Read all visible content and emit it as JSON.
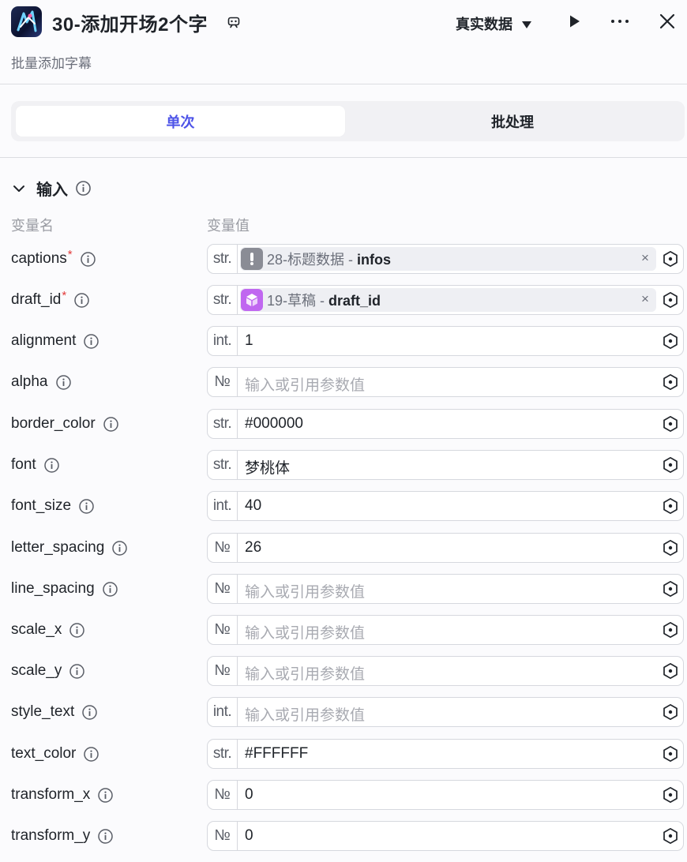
{
  "header": {
    "title": "30-添加开场2个字",
    "subtitle": "批量添加字幕",
    "mode_label": "真实数据"
  },
  "tabs": [
    {
      "label": "单次",
      "active": true
    },
    {
      "label": "批处理",
      "active": false
    }
  ],
  "section": {
    "title": "输入",
    "col_name": "变量名",
    "col_value": "变量值"
  },
  "params": [
    {
      "name": "captions",
      "required": true,
      "type": "str.",
      "ref": {
        "node": "28-标题数据",
        "sep": " - ",
        "field": "infos",
        "icon": "exclamation-icon",
        "color": "#8a8c95"
      }
    },
    {
      "name": "draft_id",
      "required": true,
      "type": "str.",
      "ref": {
        "node": "19-草稿",
        "sep": " - ",
        "field": "draft_id",
        "icon": "cube-icon",
        "color": "#c067f0"
      }
    },
    {
      "name": "alignment",
      "type": "int.",
      "value": "1"
    },
    {
      "name": "alpha",
      "type": "№",
      "placeholder": "输入或引用参数值"
    },
    {
      "name": "border_color",
      "type": "str.",
      "value": "#000000"
    },
    {
      "name": "font",
      "type": "str.",
      "value": "梦桃体"
    },
    {
      "name": "font_size",
      "type": "int.",
      "value": "40"
    },
    {
      "name": "letter_spacing",
      "type": "№",
      "value": "26"
    },
    {
      "name": "line_spacing",
      "type": "№",
      "placeholder": "输入或引用参数值"
    },
    {
      "name": "scale_x",
      "type": "№",
      "placeholder": "输入或引用参数值"
    },
    {
      "name": "scale_y",
      "type": "№",
      "placeholder": "输入或引用参数值"
    },
    {
      "name": "style_text",
      "type": "int.",
      "placeholder": "输入或引用参数值"
    },
    {
      "name": "text_color",
      "type": "str.",
      "value": "#FFFFFF"
    },
    {
      "name": "transform_x",
      "type": "№",
      "value": "0"
    },
    {
      "name": "transform_y",
      "type": "№",
      "value": "0"
    }
  ],
  "colors": {
    "accent": "#4d53e8",
    "required": "#e23a3a",
    "border": "#d6d8de",
    "ref_bg": "#eeeff3"
  }
}
